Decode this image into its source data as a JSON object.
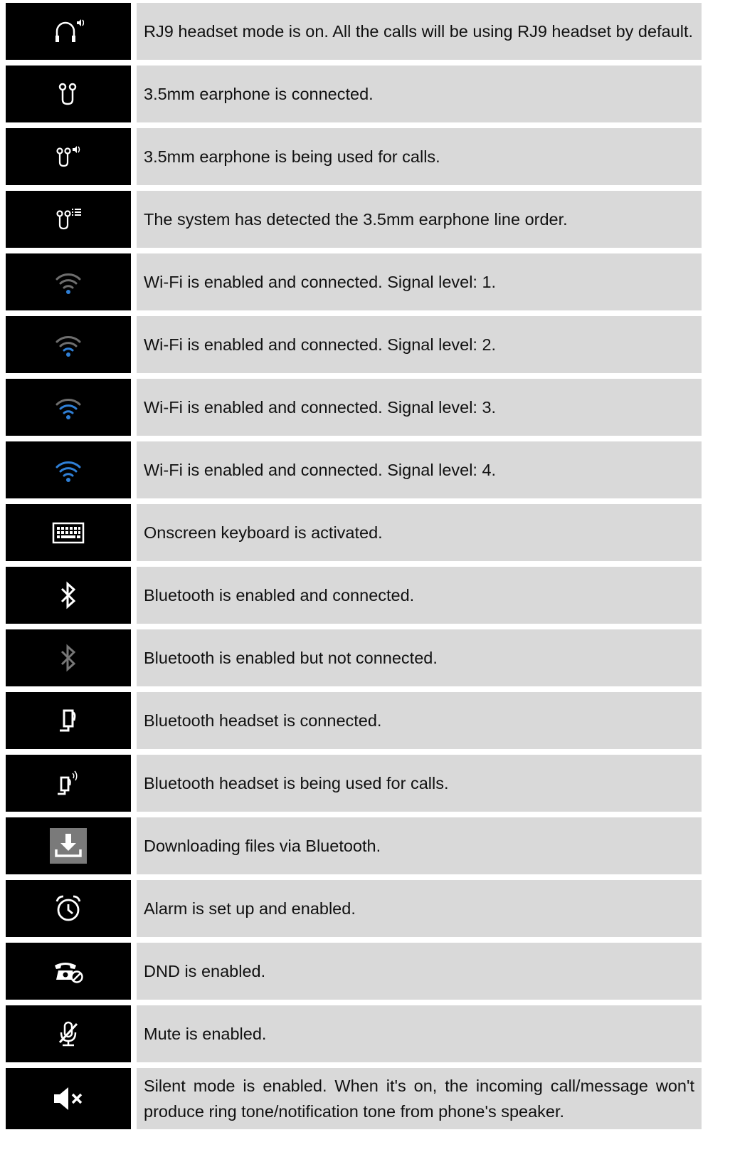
{
  "rows": [
    {
      "icon": "rj9-headset-icon",
      "text": "RJ9 headset mode is on. All the calls will be using RJ9 headset by default."
    },
    {
      "icon": "earphone-icon",
      "text": "3.5mm earphone is connected."
    },
    {
      "icon": "earphone-in-use-icon",
      "text": "3.5mm earphone is being used for calls."
    },
    {
      "icon": "earphone-line-order-icon",
      "text": "The system has detected the 3.5mm earphone line order."
    },
    {
      "icon": "wifi-signal-1-icon",
      "text": "Wi-Fi is enabled and connected. Signal level: 1.",
      "signal_level": 1
    },
    {
      "icon": "wifi-signal-2-icon",
      "text": "Wi-Fi is enabled and connected. Signal level: 2.",
      "signal_level": 2
    },
    {
      "icon": "wifi-signal-3-icon",
      "text": "Wi-Fi is enabled and connected. Signal level: 3.",
      "signal_level": 3
    },
    {
      "icon": "wifi-signal-4-icon",
      "text": "Wi-Fi is enabled and connected. Signal level: 4.",
      "signal_level": 4
    },
    {
      "icon": "keyboard-icon",
      "text": "Onscreen keyboard is activated."
    },
    {
      "icon": "bluetooth-connected-icon",
      "text": "Bluetooth is enabled and connected."
    },
    {
      "icon": "bluetooth-disconnected-icon",
      "text": "Bluetooth is enabled but not connected."
    },
    {
      "icon": "bluetooth-headset-icon",
      "text": "Bluetooth headset is connected."
    },
    {
      "icon": "bluetooth-headset-in-use-icon",
      "text": "Bluetooth headset is being used for calls."
    },
    {
      "icon": "download-icon",
      "text": "Downloading files via Bluetooth."
    },
    {
      "icon": "alarm-icon",
      "text": "Alarm is set up and enabled."
    },
    {
      "icon": "dnd-icon",
      "text": "DND is enabled."
    },
    {
      "icon": "mute-icon",
      "text": "Mute is enabled."
    },
    {
      "icon": "silent-mode-icon",
      "text": "Silent mode is enabled. When it's on, the incoming call/message won't produce ring tone/notification tone from phone's speaker."
    }
  ],
  "colors": {
    "icon_bg": "#000000",
    "text_bg": "#d9d9d9",
    "wifi_active": "#2f7fd6",
    "wifi_inactive": "#6e6e6e",
    "icon_white": "#ffffff",
    "icon_gray": "#777777"
  }
}
